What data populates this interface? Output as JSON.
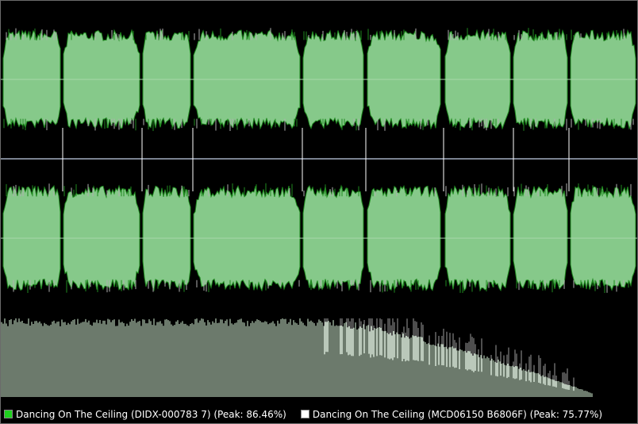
{
  "colors": {
    "background": "#000000",
    "waveform_fill": "#86c98a",
    "waveform_peak": "#1f8a1f",
    "waveform_overlay": "#b0b0b0",
    "centerline": "#a8d8aa",
    "divider": "#7a8290",
    "spectrum_a": "#d8f5d8",
    "spectrum_b": "#9c9c9c",
    "legend_swatch_a": "#1ed01e",
    "legend_swatch_b": "#ffffff"
  },
  "tracks": [
    {
      "legend_label": "Dancing On The Ceiling (DIDX-000783 7) (Peak: 86.46%)",
      "peak_percent": 86.46
    },
    {
      "legend_label": "Dancing On The Ceiling (MCD06150 B6806F) (Peak: 75.77%)",
      "peak_percent": 75.77
    }
  ]
}
